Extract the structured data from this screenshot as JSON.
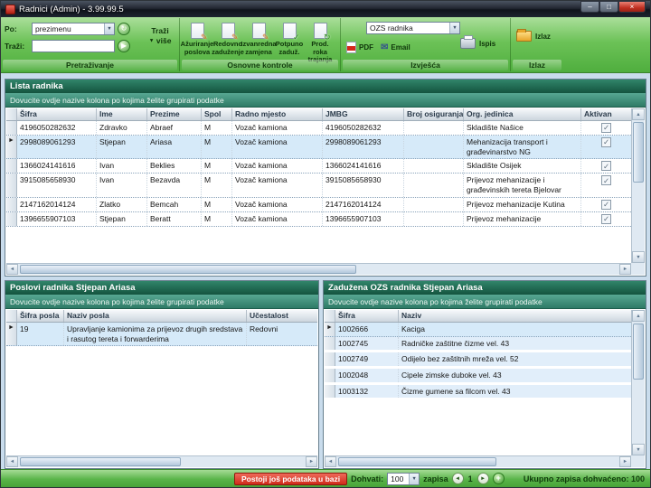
{
  "window": {
    "title": "Radnici (Admin) - 3.99.99.5"
  },
  "icons": {
    "minimize": "–",
    "maximize": "□",
    "close": "×",
    "dropdown_arrow": "▼",
    "refresh": "↻",
    "go": "▶",
    "pencil": "✎",
    "check": "✓",
    "row_arrow": "►",
    "scroll_up": "▲",
    "scroll_down": "▼",
    "scroll_left": "◄",
    "scroll_right": "►",
    "prev": "◄",
    "next": "►",
    "add": "+",
    "email": "✉"
  },
  "ribbon": {
    "search": {
      "po_label": "Po:",
      "po_value": "prezimenu",
      "trazi_label": "Traži:",
      "trazi_value": "",
      "trazi_vise_line1": "Traži",
      "trazi_vise_line2": "više",
      "group_label": "Pretraživanje"
    },
    "controls": {
      "buttons": [
        "Ažuriranje poslova",
        "Redovno zaduženje",
        "Izvanredna zamjena",
        "Potpuno zaduž.",
        "Prod. roka trajanja"
      ],
      "group_label": "Osnovne kontrole"
    },
    "reports": {
      "dropdown_value": "OZS radnika",
      "pdf_label": "PDF",
      "email_label": "Email",
      "print_label": "Ispis",
      "group_label": "Izvješća"
    },
    "exit": {
      "button_label": "Izlaz",
      "group_label": "Izlaz"
    }
  },
  "workers": {
    "title": "Lista radnika",
    "hint": "Dovucite ovdje nazive kolona po kojima želite grupirati podatke",
    "columns": [
      "Šifra",
      "Ime",
      "Prezime",
      "Spol",
      "Radno mjesto",
      "JMBG",
      "Broj osiguranja",
      "Org. jedinica",
      "Aktivan"
    ],
    "rows": [
      {
        "sifra": "4196050282632",
        "ime": "Zdravko",
        "prezime": "Abraef",
        "spol": "M",
        "radno_mjesto": "Vozač kamiona",
        "jmbg": "4196050282632",
        "broj_osiguranja": "",
        "org_jedinica": "Skladište Našice"
      },
      {
        "sifra": "2998089061293",
        "ime": "Stjepan",
        "prezime": "Ariasa",
        "spol": "M",
        "radno_mjesto": "Vozač kamiona",
        "jmbg": "2998089061293",
        "broj_osiguranja": "",
        "org_jedinica": "Mehanizacija transport i građevinarstvo NG"
      },
      {
        "sifra": "1366024141616",
        "ime": "Ivan",
        "prezime": "Beklies",
        "spol": "M",
        "radno_mjesto": "Vozač kamiona",
        "jmbg": "1366024141616",
        "broj_osiguranja": "",
        "org_jedinica": "Skladište Osijek"
      },
      {
        "sifra": "3915085658930",
        "ime": "Ivan",
        "prezime": "Bezavda",
        "spol": "M",
        "radno_mjesto": "Vozač kamiona",
        "jmbg": "3915085658930",
        "broj_osiguranja": "",
        "org_jedinica": "Prijevoz mehanizacije i građevinskih tereta Bjelovar"
      },
      {
        "sifra": "2147162014124",
        "ime": "Zlatko",
        "prezime": "Bemcah",
        "spol": "M",
        "radno_mjesto": "Vozač kamiona",
        "jmbg": "2147162014124",
        "broj_osiguranja": "",
        "org_jedinica": "Prijevoz mehanizacije Kutina"
      },
      {
        "sifra": "1396655907103",
        "ime": "Stjepan",
        "prezime": "Beratt",
        "spol": "M",
        "radno_mjesto": "Vozač kamiona",
        "jmbg": "1396655907103",
        "broj_osiguranja": "",
        "org_jedinica": "Prijevoz mehanizacije"
      }
    ]
  },
  "jobs": {
    "title": "Poslovi radnika Stjepan Ariasa",
    "hint": "Dovucite ovdje nazive kolona po kojima želite grupirati podatke",
    "columns": [
      "Šifra posla",
      "Naziv posla",
      "Učestalost"
    ],
    "rows": [
      {
        "sifra_posla": "19",
        "naziv_posla": "Upravljanje kamionima za prijevoz drugih sredstava i rasutog tereta i forwarderima",
        "ucestalost": "Redovni"
      }
    ]
  },
  "ozs": {
    "title": "Zadužena OZS radnika Stjepan Ariasa",
    "hint": "Dovucite ovdje nazive kolona po kojima želite grupirati podatke",
    "columns": [
      "Šifra",
      "Naziv"
    ],
    "rows": [
      {
        "sifra": "1002666",
        "naziv": "Kaciga"
      },
      {
        "sifra": "1002745",
        "naziv": "Radničke zaštitne čizme vel. 43"
      },
      {
        "sifra": "1002749",
        "naziv": "Odijelo bez zaštitnih mreža vel. 52"
      },
      {
        "sifra": "1002048",
        "naziv": "Cipele zimske duboke vel. 43"
      },
      {
        "sifra": "1003132",
        "naziv": "Čizme gumene sa filcom vel. 43"
      }
    ]
  },
  "statusbar": {
    "alert": "Postoji još podataka u bazi",
    "dohvati_label": "Dohvati:",
    "dohvati_value": "100",
    "zapisa_label": "zapisa",
    "page": "1",
    "total_label": "Ukupno zapisa dohvaćeno:",
    "total_value": "100"
  }
}
